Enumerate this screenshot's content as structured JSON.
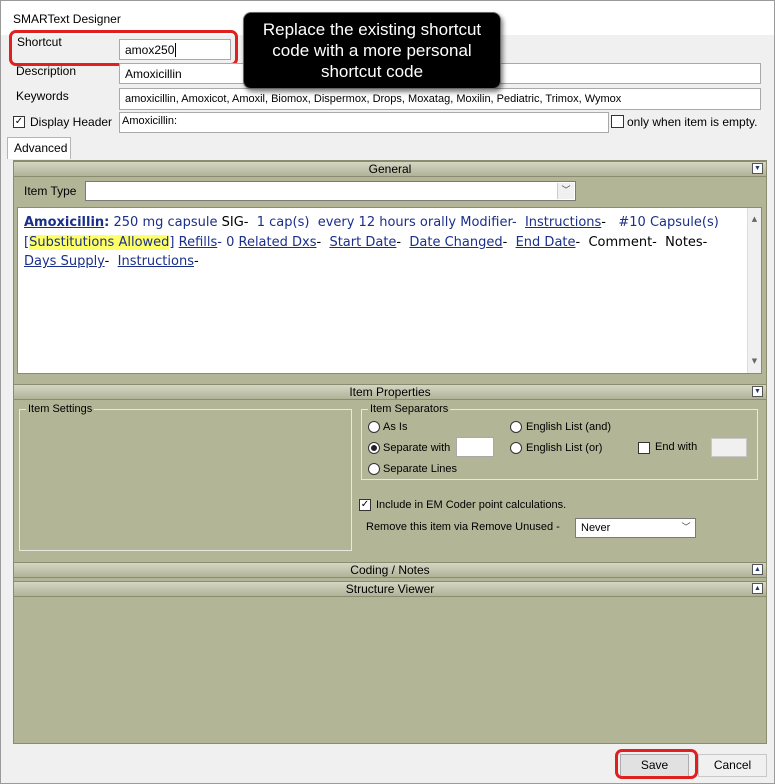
{
  "window": {
    "title": "SMARText Designer"
  },
  "tooltip": {
    "text": "Replace the existing shortcut code with a more personal shortcut code"
  },
  "form": {
    "shortcut_label": "Shortcut",
    "shortcut_value": "amox250",
    "description_label": "Description",
    "description_value": "Amoxicillin",
    "keywords_label": "Keywords",
    "keywords_value": "amoxicillin, Amoxicot, Amoxil, Biomox, Dispermox, Drops, Moxatag, Moxilin, Pediatric, Trimox, Wymox",
    "display_header_label": "Display Header",
    "display_header_checked": true,
    "header_value": "Amoxicillin:",
    "only_when_empty_label": "only when item is empty.",
    "only_when_empty_checked": false
  },
  "tabs": [
    {
      "label": "Advanced"
    }
  ],
  "general": {
    "header": "General",
    "item_type_label": "Item Type",
    "item_type_value": "",
    "text": {
      "name": "Amoxicillin",
      "colon": ":",
      "dose": " 250 mg capsule ",
      "sig": "SIG-",
      "caps": "  1 cap(s)  every 12 hours orally ",
      "modifier": "Modifier-",
      "instructions1": "Instructions",
      "dash1": "-",
      "qty": "   #10 Capsule(s)",
      "bracket_open": "[",
      "substitutions": "Substitutions Allowed",
      "bracket_close": "]",
      "refills": "Refills",
      "refills_val": "- 0 ",
      "related": "Related Dxs",
      "dash2": "-  ",
      "start": "Start Date",
      "dash3": "-  ",
      "changed": "Date Changed",
      "dash4": "-  ",
      "end": "End Date",
      "dash5": "-  ",
      "comment": "Comment-",
      "notes": "Notes-",
      "days": "Days Supply",
      "dash6": "-  ",
      "instructions2": "Instructions",
      "dash7": "-"
    }
  },
  "item_properties": {
    "header": "Item Properties",
    "item_settings_label": "Item Settings",
    "item_separators_label": "Item Separators",
    "radio_as_is": "As Is",
    "radio_separate_with": "Separate with",
    "radio_separate_lines": "Separate Lines",
    "radio_english_and": "English List (and)",
    "radio_english_or": "English List (or)",
    "selected_separator": "Separate with",
    "end_with_label": "End with",
    "include_em_label": "Include in EM Coder point calculations.",
    "include_em_checked": true,
    "remove_unused_label": "Remove this item via Remove Unused -",
    "remove_unused_value": "Never"
  },
  "coding_notes": {
    "header": "Coding / Notes"
  },
  "structure_viewer": {
    "header": "Structure Viewer"
  },
  "buttons": {
    "save": "Save",
    "cancel": "Cancel"
  },
  "colors": {
    "accent_red": "#e01f1f",
    "panel_olive": "#b3b597",
    "link_navy": "#1a2f8a"
  }
}
